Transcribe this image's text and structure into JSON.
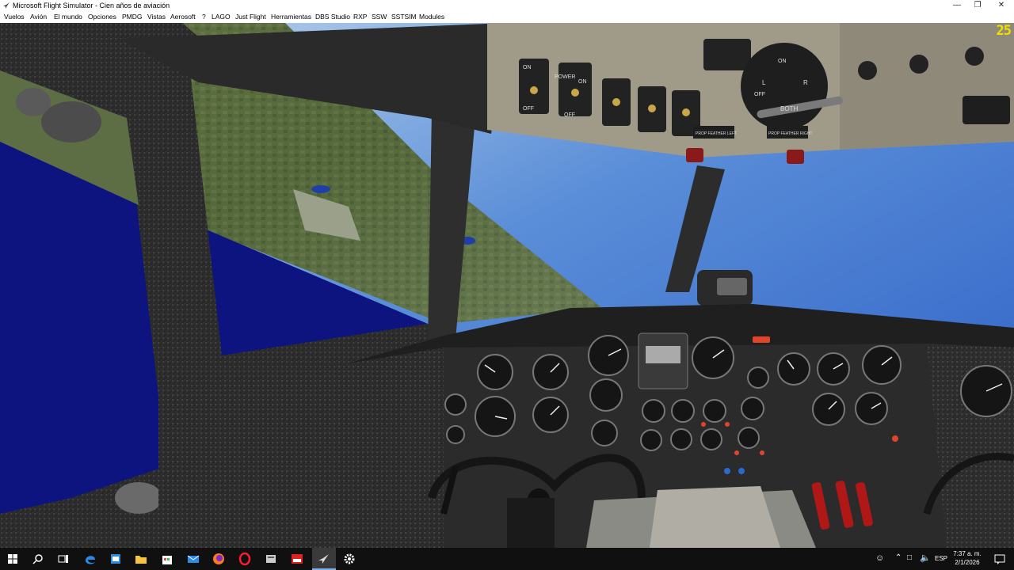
{
  "window": {
    "title": "Microsoft Flight Simulator - Cien años de aviación",
    "controls": [
      "minimize",
      "maximize",
      "close"
    ]
  },
  "menu": {
    "items": [
      "Vuelos",
      "Avión",
      "El mundo",
      "Opciones",
      "PMDG",
      "Vistas",
      "Aerosoft",
      "?",
      "LAGO",
      "Just Flight",
      "Herramientas",
      "DBS Studio",
      "RXP",
      "SSW",
      "SSTSIM",
      "Modules"
    ]
  },
  "hud": {
    "fps": "25"
  },
  "cockpit": {
    "labels": {
      "off_left": "OFF",
      "on_left": "ON",
      "power": "POWER",
      "on_right": "ON",
      "off_right": "OFF",
      "prop_feather_left": "PROP FEATHER LEFT",
      "prop_feather_right": "PROP FEATHER RIGHT",
      "magneto_both": "BOTH",
      "magneto_l": "L",
      "magneto_r": "R",
      "magneto_off": "OFF",
      "magneto_on": "ON"
    }
  },
  "taskbar": {
    "icons": [
      "windows-start-icon",
      "search-icon",
      "task-view-icon",
      "edge-icon",
      "store-icon",
      "file-explorer-icon",
      "store-bag-icon",
      "mail-icon",
      "firefox-icon",
      "opera-icon",
      "app-icon",
      "app-red-icon",
      "flight-simulator-icon",
      "settings-icon"
    ],
    "language": "ESP",
    "time": "7:37 a. m.",
    "date": "2/1/2026"
  }
}
